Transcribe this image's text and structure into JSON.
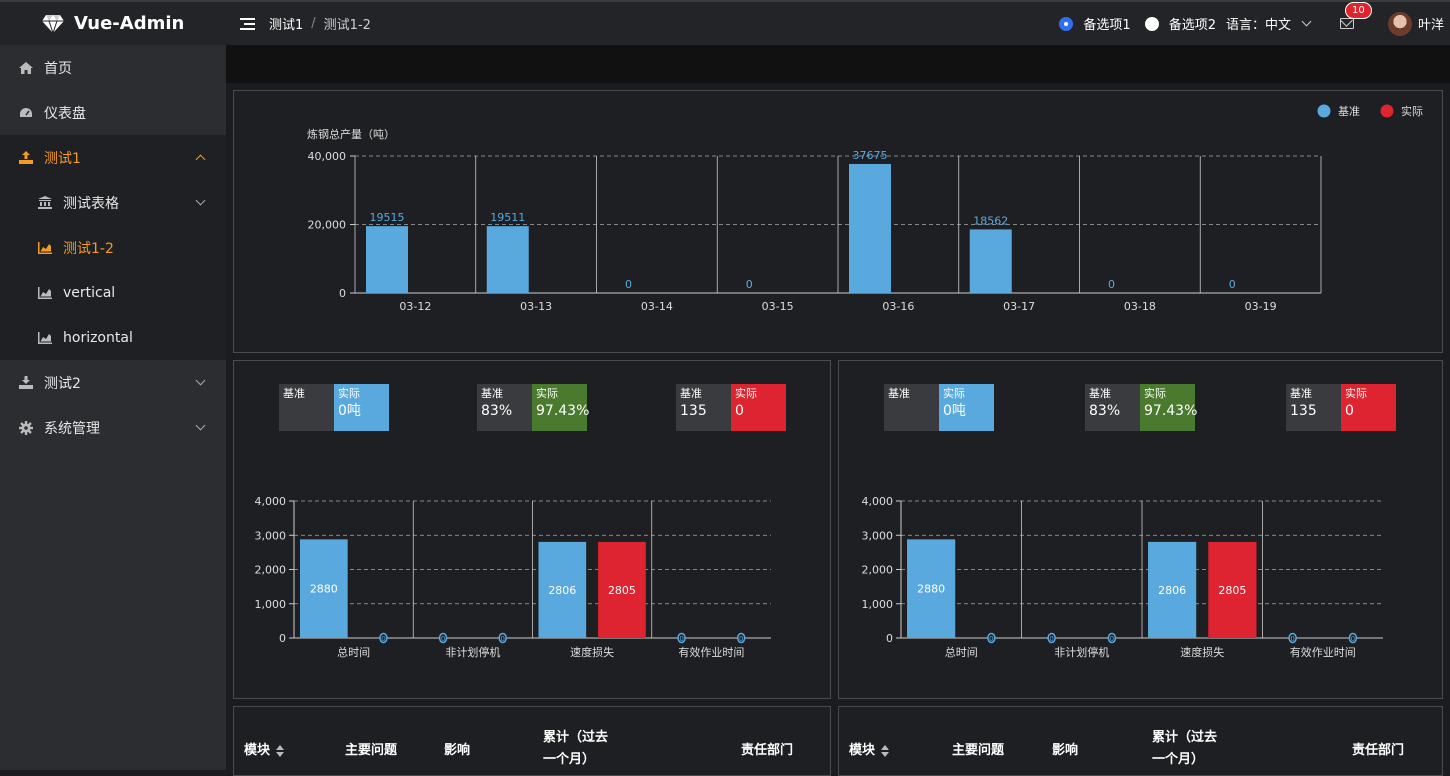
{
  "app": {
    "title": "Vue-Admin"
  },
  "breadcrumb": {
    "level1": "测试1",
    "level2": "测试1-2"
  },
  "header": {
    "option1": "备选项1",
    "option2": "备选项2",
    "language_label": "语言：中文",
    "mail_badge": "10",
    "user_name": "叶洋"
  },
  "sidebar": {
    "items": [
      {
        "label": "首页",
        "icon": "home-icon"
      },
      {
        "label": "仪表盘",
        "icon": "dashboard-icon"
      },
      {
        "label": "测试1",
        "icon": "upload-icon",
        "expanded": true
      },
      {
        "label": "测试表格",
        "icon": "bank-icon"
      },
      {
        "label": "测试1-2",
        "icon": "area-chart-icon",
        "active": true
      },
      {
        "label": "vertical",
        "icon": "area-chart-icon"
      },
      {
        "label": "horizontal",
        "icon": "area-chart-icon"
      },
      {
        "label": "测试2",
        "icon": "download-icon"
      },
      {
        "label": "系统管理",
        "icon": "gear-icon"
      }
    ]
  },
  "colors": {
    "base": "#59a9df",
    "actual": "#de2430",
    "green": "#4a7a2e",
    "accent": "#f59a23"
  },
  "chart_data": [
    {
      "type": "bar",
      "ylabel": "炼钢总产量（吨）",
      "categories": [
        "03-12",
        "03-13",
        "03-14",
        "03-15",
        "03-16",
        "03-17",
        "03-18",
        "03-19"
      ],
      "series": [
        {
          "name": "基准",
          "values": [
            19515,
            19511,
            0,
            0,
            37675,
            18562,
            0,
            0
          ]
        },
        {
          "name": "实际",
          "values": [
            0,
            0,
            0,
            0,
            0,
            0,
            0,
            0
          ]
        }
      ],
      "ylim": [
        0,
        40000
      ],
      "yticks": [
        "0",
        "20,000",
        "40,000"
      ],
      "legend": "top-right"
    },
    {
      "type": "bar",
      "categories": [
        "总时间",
        "非计划停机",
        "速度损失",
        "有效作业时间"
      ],
      "series": [
        {
          "name": "基准",
          "values": [
            2880,
            0,
            2806,
            0
          ]
        },
        {
          "name": "实际",
          "values": [
            0,
            0,
            2805,
            0
          ]
        }
      ],
      "ylim": [
        0,
        4000
      ],
      "yticks": [
        "0",
        "1,000",
        "2,000",
        "3,000",
        "4,000"
      ]
    },
    {
      "type": "bar",
      "categories": [
        "总时间",
        "非计划停机",
        "速度损失",
        "有效作业时间"
      ],
      "series": [
        {
          "name": "基准",
          "values": [
            2880,
            0,
            2806,
            0
          ]
        },
        {
          "name": "实际",
          "values": [
            0,
            0,
            2805,
            0
          ]
        }
      ],
      "ylim": [
        0,
        4000
      ],
      "yticks": [
        "0",
        "1,000",
        "2,000",
        "3,000",
        "4,000"
      ]
    }
  ],
  "kpis": [
    {
      "base_label": "基准",
      "base_value": "",
      "actual_label": "实际",
      "actual_value": "0吨",
      "color": "#59a9df"
    },
    {
      "base_label": "基准",
      "base_value": "83%",
      "actual_label": "实际",
      "actual_value": "97.43%",
      "color": "#4a7a2e"
    },
    {
      "base_label": "基准",
      "base_value": "135",
      "actual_label": "实际",
      "actual_value": "0",
      "color": "#de2430"
    }
  ],
  "table": {
    "headers": [
      "模块",
      "主要问题",
      "影响",
      "累计（过去",
      "一个月）",
      "责任部门"
    ]
  }
}
